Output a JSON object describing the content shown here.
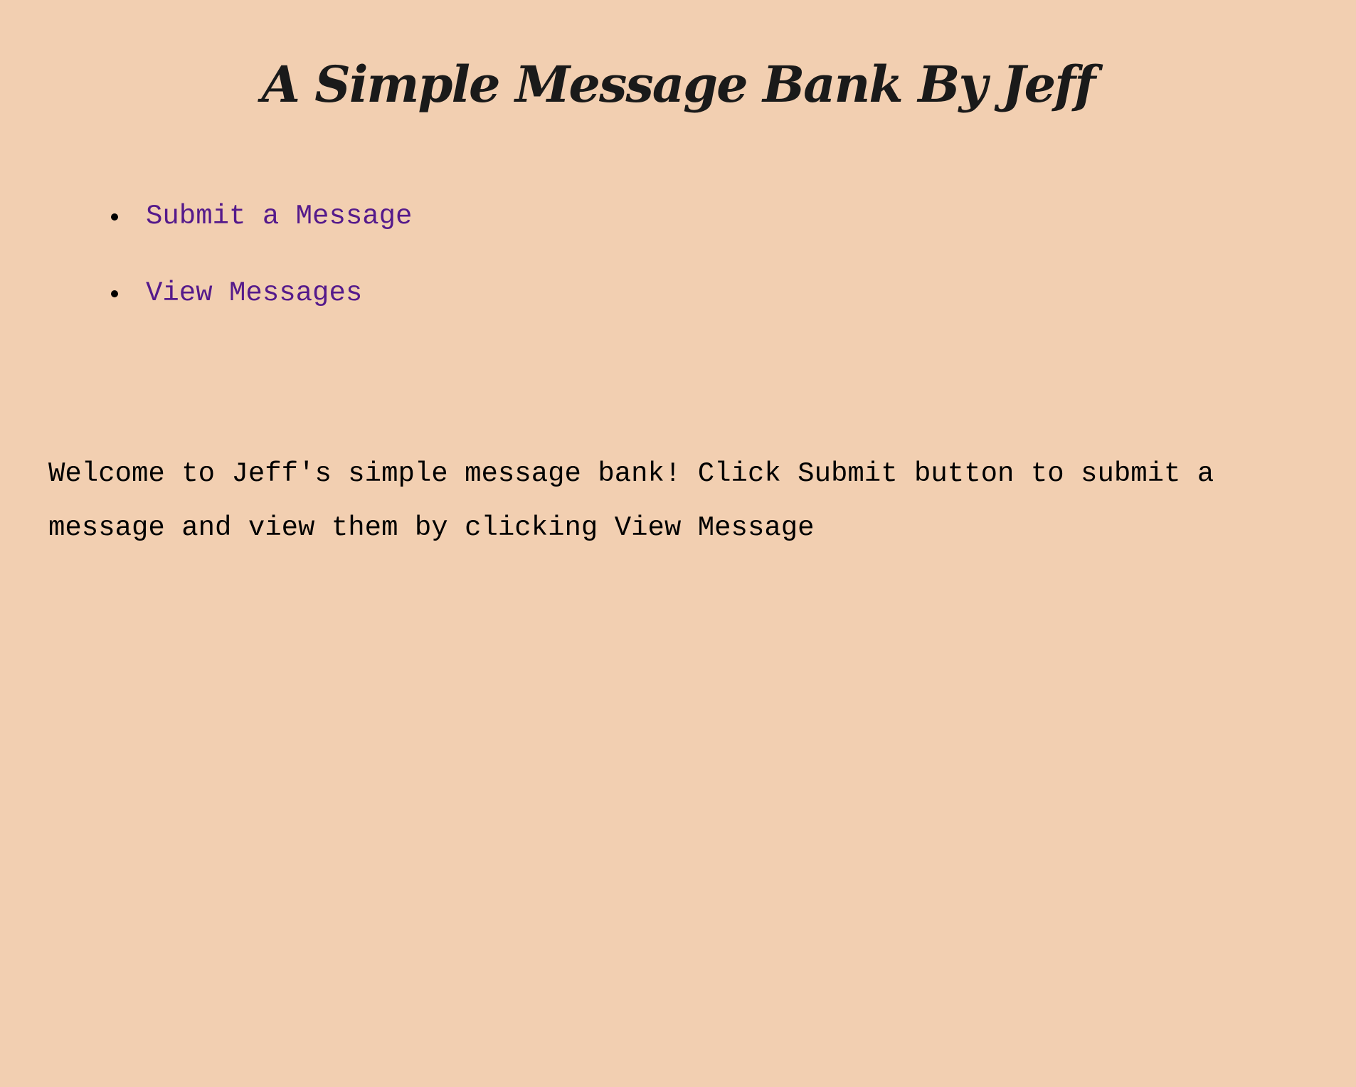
{
  "header": {
    "title": "A Simple Message Bank By Jeff"
  },
  "nav": {
    "items": [
      {
        "label": "Submit a Message"
      },
      {
        "label": "View Messages"
      }
    ]
  },
  "main": {
    "welcome_text": "Welcome to Jeff's simple message bank! Click Submit button to submit a message and view them by clicking View Message"
  },
  "colors": {
    "background": "#f2cfb1",
    "link": "#551a8b",
    "text": "#000000"
  }
}
